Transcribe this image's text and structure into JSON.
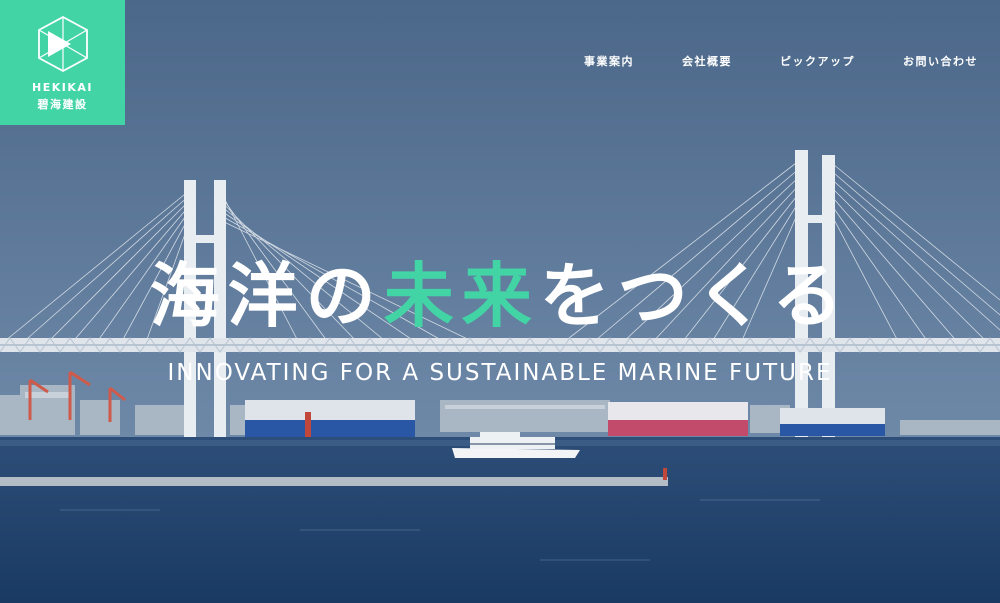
{
  "logo": {
    "name_en": "HEKIKAI",
    "name_ja": "碧海建設",
    "icon": "play-hexagon-icon",
    "color": "#43d4a6"
  },
  "nav": {
    "items": [
      {
        "label": "事業案内"
      },
      {
        "label": "会社概要"
      },
      {
        "label": "ピックアップ"
      },
      {
        "label": "お問い合わせ"
      }
    ]
  },
  "hero": {
    "headline_part1": "海洋の",
    "headline_accent": "未来",
    "headline_part2": "をつくる",
    "subline": "INNOVATING FOR A SUSTAINABLE MARINE FUTURE",
    "accent_color": "#43d4a6"
  }
}
